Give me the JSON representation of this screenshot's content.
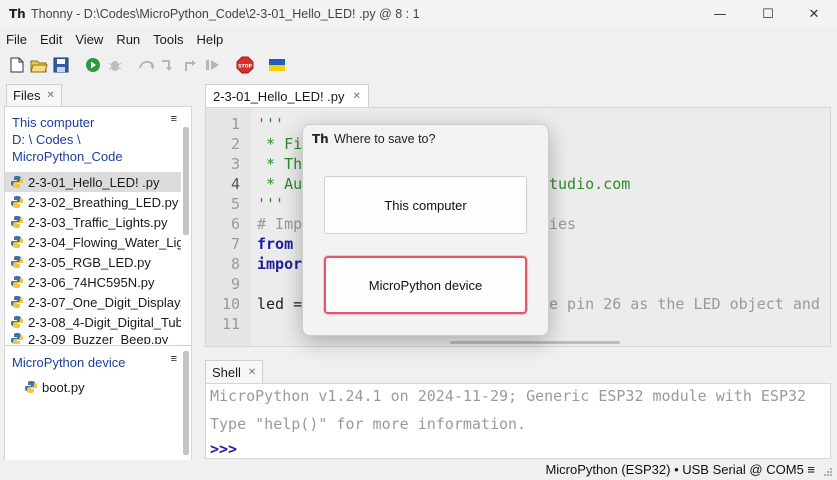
{
  "window": {
    "title": "Thonny  -  D:\\Codes\\MicroPython_Code\\2-3-01_Hello_LED! .py  @  8 : 1",
    "minimize_glyph": "—",
    "maximize_glyph": "☐",
    "close_glyph": "✕"
  },
  "menubar": {
    "items": [
      "File",
      "Edit",
      "View",
      "Run",
      "Tools",
      "Help"
    ]
  },
  "toolbar": {
    "icons": [
      "new-file-icon",
      "open-folder-icon",
      "save-disk-icon",
      "run-play-icon",
      "debug-bug-icon",
      "step-over-icon",
      "step-into-icon",
      "step-out-icon",
      "resume-icon",
      "stop-sign-icon",
      "ukraine-flag-icon"
    ],
    "stop_label": "STOP"
  },
  "files": {
    "tab_label": "Files",
    "this_computer_label": "This computer",
    "path_line_1": "D: \\ Codes \\",
    "path_line_2": "MicroPython_Code",
    "items": [
      "2-3-01_Hello_LED! .py",
      "2-3-02_Breathing_LED.py",
      "2-3-03_Traffic_Lights.py",
      "2-3-04_Flowing_Water_Ligh",
      "2-3-05_RGB_LED.py",
      "2-3-06_74HC595N.py",
      "2-3-07_One_Digit_Display.p",
      "2-3-08_4-Digit_Digital_Tub",
      "2-3-09_Buzzer_Beep.py"
    ],
    "selected_index": 0,
    "device_label": "MicroPython device",
    "device_items": [
      "boot.py"
    ]
  },
  "editor": {
    "tab_label": "2-3-01_Hello_LED! .py",
    "line_numbers": [
      "1",
      "2",
      "3",
      "4",
      "5",
      "6",
      "7",
      "8",
      "9",
      "10",
      "11"
    ],
    "line_1": "'''",
    "line_2": " * Fi",
    "line_3": " * The",
    "line_4": " * Aut",
    "line_4_tail": "tudio.com",
    "line_5": "'''",
    "line_6": "# Impo",
    "line_6_tail": "ies",
    "line_7": "from m",
    "line_8": "import",
    "line_10": "led = ",
    "line_10_tail": "e pin 26 as the LED object and"
  },
  "shell": {
    "tab_label": "Shell",
    "line_1": "MicroPython v1.24.1 on 2024-11-29; Generic ESP32 module with ESP32",
    "line_2": "Type \"help()\" for more information.",
    "prompt": ">>>"
  },
  "statusbar": {
    "text": "MicroPython (ESP32)  •  USB Serial @ COM5  ≡"
  },
  "dialog": {
    "title": "Where to save to?",
    "this_computer_button": "This computer",
    "device_button": "MicroPython device"
  },
  "colors": {
    "highlight_border": "#e85468",
    "path_blue": "#1d3f9b",
    "keyword_blue": "#1d1da0"
  }
}
